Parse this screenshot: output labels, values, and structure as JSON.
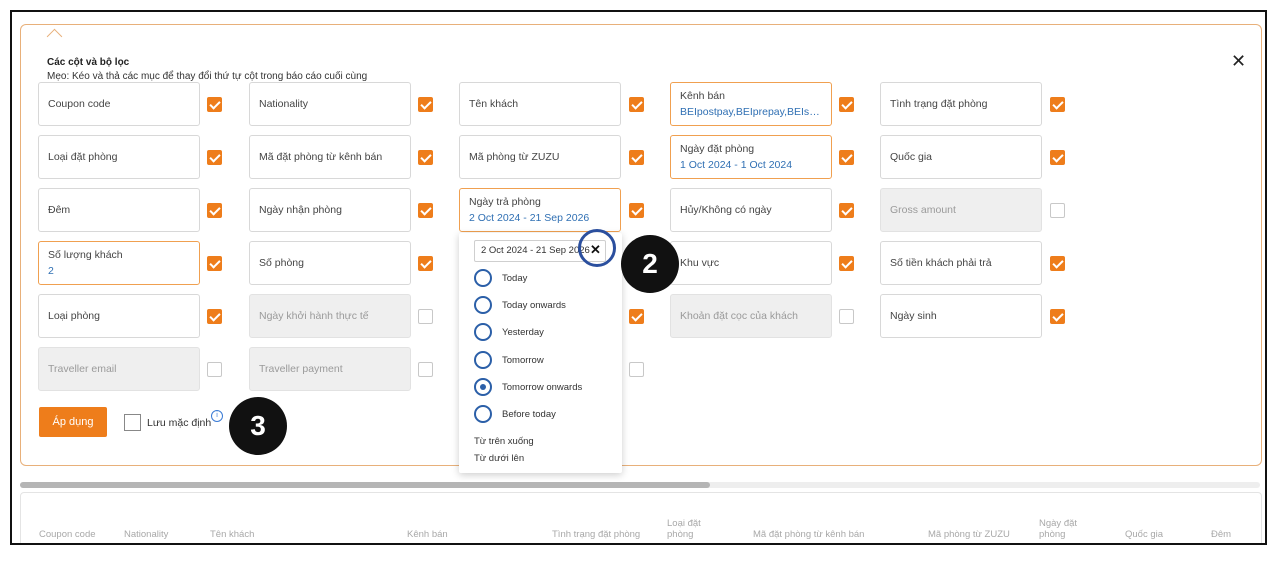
{
  "panel": {
    "title": "Các cột và bộ lọc",
    "tip": "Mẹo: Kéo và thả các mục để thay đổi thứ tự cột trong báo cáo cuối cùng",
    "close_symbol": "✕"
  },
  "fields": [
    {
      "label": "Coupon code",
      "checked": true
    },
    {
      "label": "Nationality",
      "checked": true
    },
    {
      "label": "Tên khách",
      "checked": true
    },
    {
      "label": "Kênh bán",
      "sub": "BEIpostpay,BEIprepay,BEIsc…",
      "checked": true
    },
    {
      "label": "Tình trạng đặt phòng",
      "checked": true
    },
    {
      "label": "Loại đặt phòng",
      "checked": true
    },
    {
      "label": "Mã đặt phòng từ kênh bán",
      "checked": true
    },
    {
      "label": "Mã phòng từ ZUZU",
      "checked": true
    },
    {
      "label": "Ngày đặt phòng",
      "sub": "1 Oct 2024 - 1 Oct 2024",
      "checked": true
    },
    {
      "label": "Quốc gia",
      "checked": true
    },
    {
      "label": "Đêm",
      "checked": true
    },
    {
      "label": "Ngày nhận phòng",
      "checked": true
    },
    {
      "label": "Ngày trả phòng",
      "sub": "2 Oct 2024 - 21 Sep 2026",
      "checked": true
    },
    {
      "label": "Hủy/Không có ngày",
      "checked": true
    },
    {
      "label": "Gross amount",
      "checked": false,
      "disabled": true
    },
    {
      "label": "Số lượng khách",
      "sub": "2",
      "checked": true
    },
    {
      "label": "Số phòng",
      "checked": true
    },
    {
      "label": "Khu vực",
      "checked": true
    },
    {
      "label": "Số tiền khách phải trả",
      "checked": true
    },
    {
      "label": "Loại phòng",
      "checked": true
    },
    {
      "label": "Ngày khởi hành thực tế",
      "checked": false,
      "disabled": true
    },
    {
      "label": "Khoản đặt cọc của khách",
      "checked": false,
      "disabled": true
    },
    {
      "label": "Ngày sinh",
      "checked": true
    },
    {
      "label": "Traveller email",
      "checked": false,
      "disabled": true
    },
    {
      "label": "Traveller payment",
      "checked": false,
      "disabled": true
    }
  ],
  "hidden_row_checkboxes": [
    true,
    false
  ],
  "actions": {
    "apply_label": "Áp dụng",
    "save_default_label": "Lưu mặc định"
  },
  "dropdown": {
    "value": "2 Oct 2024 - 21 Sep 2026",
    "clear_symbol": "✕",
    "options": [
      "Today",
      "Today onwards",
      "Yesterday",
      "Tomorrow",
      "Tomorrow onwards",
      "Before today"
    ],
    "selected_option": "Tomorrow onwards",
    "sort_options": [
      "Từ trên xuống",
      "Từ dưới lên"
    ]
  },
  "annotations": [
    "2",
    "3"
  ],
  "table": {
    "headers": [
      "Coupon code",
      "Nationality",
      "Tên khách",
      "Kênh bán",
      "Tình trạng đặt phòng",
      "Loại đặt phòng",
      "Mã đặt phòng từ kênh bán",
      "Mã phòng từ ZUZU",
      "Ngày đặt phòng",
      "Quốc gia",
      "Đêm"
    ]
  },
  "colors": {
    "accent": "#ee7d1b",
    "link": "#2f6fb3",
    "annotation_ring": "#2b4f9e"
  }
}
